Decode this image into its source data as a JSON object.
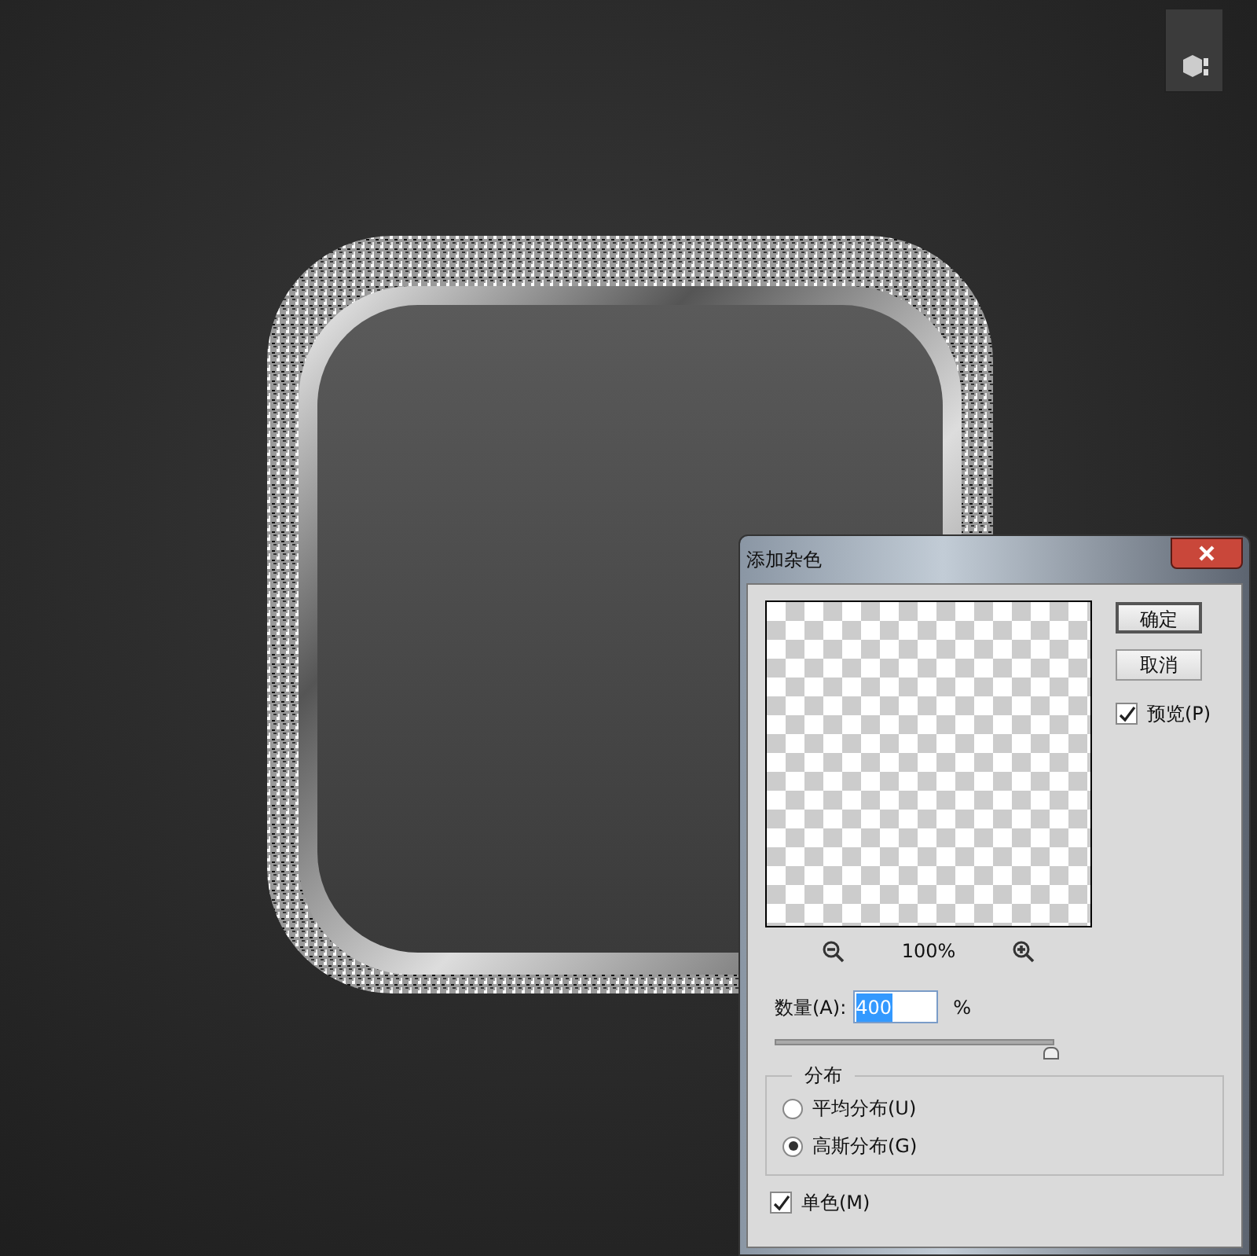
{
  "dialog": {
    "title": "添加杂色",
    "buttons": [
      {
        "label": "确定",
        "selected": true
      },
      {
        "label": "取消",
        "selected": false
      }
    ],
    "preview": {
      "label": "预览(P)",
      "checked": true
    },
    "zoom": {
      "value": "100%"
    },
    "amount": {
      "label": "数量(A):",
      "value": "400",
      "unit": "%",
      "level": 1
    },
    "distribution": {
      "legend": "分布",
      "options": [
        {
          "label": "平均分布(U)",
          "selected": false
        },
        {
          "label": "高斯分布(G)",
          "selected": true
        }
      ]
    },
    "monochromatic": {
      "label": "单色(M)",
      "checked": true
    }
  }
}
